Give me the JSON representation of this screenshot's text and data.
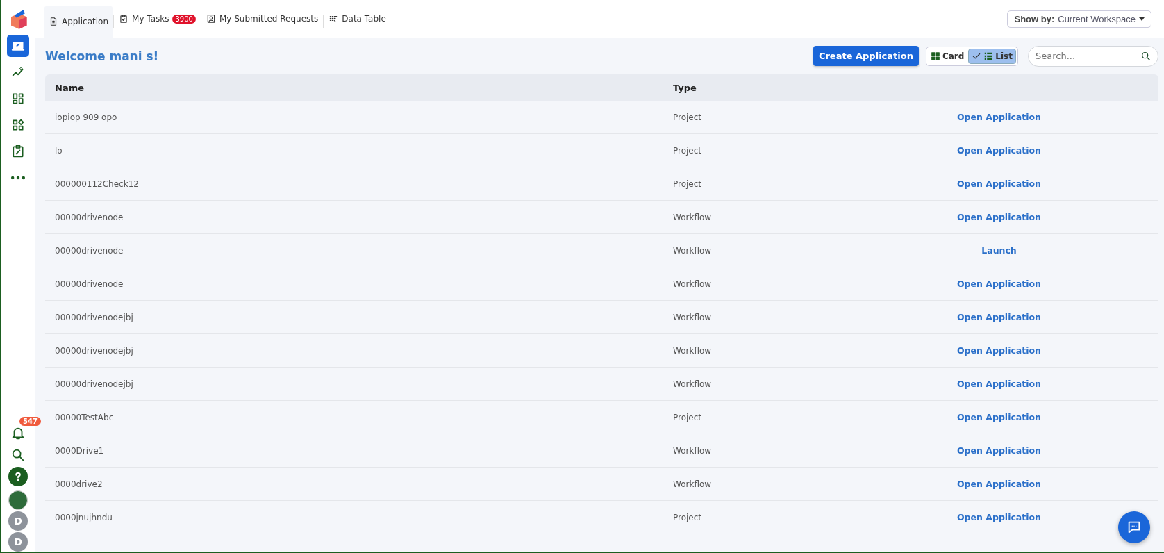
{
  "sidebar": {
    "items": [
      {
        "kind": "monitor",
        "selected": true
      },
      {
        "kind": "chart",
        "selected": false
      },
      {
        "kind": "grid",
        "selected": false
      },
      {
        "kind": "grid-plus",
        "selected": false
      },
      {
        "kind": "clipboard",
        "selected": false
      },
      {
        "kind": "more",
        "selected": false
      }
    ],
    "notifications": {
      "count": "547"
    },
    "users": [
      {
        "kind": "photo"
      },
      {
        "kind": "letter",
        "initial": "D"
      },
      {
        "kind": "letter",
        "initial": "D"
      }
    ]
  },
  "tabs": [
    {
      "label": "Application",
      "kind": "doc",
      "selected": true
    },
    {
      "label": "My Tasks",
      "kind": "tasks",
      "selected": false,
      "badge": "3900"
    },
    {
      "label": "My Submitted Requests",
      "kind": "person",
      "selected": false
    },
    {
      "label": "Data Table",
      "kind": "table",
      "selected": false
    }
  ],
  "show_by": {
    "label": "Show by:",
    "value": "Current Workspace"
  },
  "welcome": "Welcome mani s!",
  "create_button": "Create Application",
  "view_toggle": [
    {
      "label": "Card",
      "kind": "card",
      "selected": false
    },
    {
      "label": "List",
      "kind": "list",
      "selected": true
    }
  ],
  "search": {
    "placeholder": "Search..."
  },
  "table": {
    "columns": [
      "Name",
      "Type"
    ],
    "rows": [
      {
        "name": "iopiop 909 opo",
        "type": "Project",
        "action": "Open Application"
      },
      {
        "name": "lo",
        "type": "Project",
        "action": "Open Application"
      },
      {
        "name": "000000112Check12",
        "type": "Project",
        "action": "Open Application"
      },
      {
        "name": "00000drivenode",
        "type": "Workflow",
        "action": "Open Application"
      },
      {
        "name": "00000drivenode",
        "type": "Workflow",
        "action": "Launch"
      },
      {
        "name": "00000drivenode",
        "type": "Workflow",
        "action": "Open Application"
      },
      {
        "name": "00000drivenodejbj",
        "type": "Workflow",
        "action": "Open Application"
      },
      {
        "name": "00000drivenodejbj",
        "type": "Workflow",
        "action": "Open Application"
      },
      {
        "name": "00000drivenodejbj",
        "type": "Workflow",
        "action": "Open Application"
      },
      {
        "name": "00000TestAbc",
        "type": "Project",
        "action": "Open Application"
      },
      {
        "name": "0000Drive1",
        "type": "Workflow",
        "action": "Open Application"
      },
      {
        "name": "0000drive2",
        "type": "Workflow",
        "action": "Open Application"
      },
      {
        "name": "0000jnujhndu",
        "type": "Project",
        "action": "Open Application"
      }
    ]
  }
}
